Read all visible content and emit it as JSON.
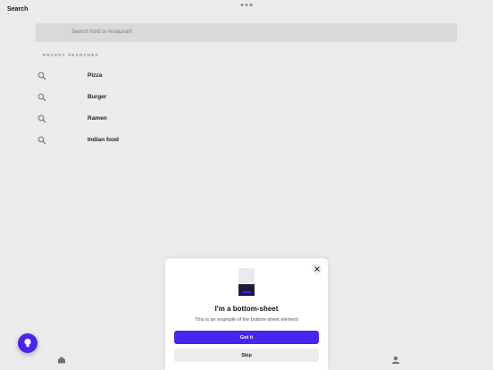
{
  "header": {
    "title": "Search"
  },
  "search": {
    "placeholder": "Search food or restaurant"
  },
  "recent": {
    "section_label": "RECENT SEARCHES",
    "items": [
      {
        "label": "Pizza",
        "icon": "search-icon"
      },
      {
        "label": "Burger",
        "icon": "search-icon"
      },
      {
        "label": "Ramen",
        "icon": "search-icon"
      },
      {
        "label": "Indian food",
        "icon": "search-icon"
      }
    ]
  },
  "bottom_sheet": {
    "title": "I'm a bottom-sheet",
    "description": "This is an example of the bottom-sheet element",
    "primary_label": "Got it",
    "secondary_label": "Skip",
    "close_icon": "close-icon",
    "illustration": "phone-illustration"
  },
  "fab": {
    "icon": "lightbulb-icon"
  },
  "tabbar": {
    "icons": [
      "home-icon",
      "profile-icon"
    ]
  },
  "colors": {
    "accent": "#4a24f0",
    "surface": "#ececec",
    "text": "#111111"
  }
}
